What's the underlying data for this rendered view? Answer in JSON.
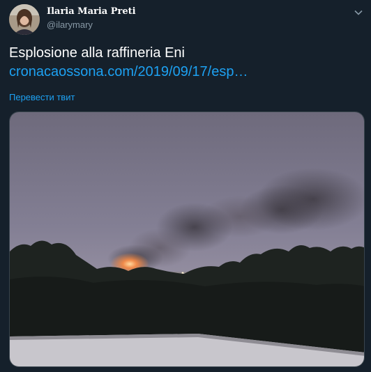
{
  "author": {
    "name": "Ilaria Maria Preti",
    "handle": "@ilarymary"
  },
  "tweet": {
    "text": "Esplosione alla raffineria Eni",
    "link": "cronacaossona.com/2019/09/17/esp…",
    "translate_label": "Перевести твит"
  },
  "colors": {
    "background": "#15202b",
    "link": "#1da1f2",
    "secondary_text": "#8899a6"
  },
  "icons": {
    "caret": "chevron-down-icon"
  }
}
